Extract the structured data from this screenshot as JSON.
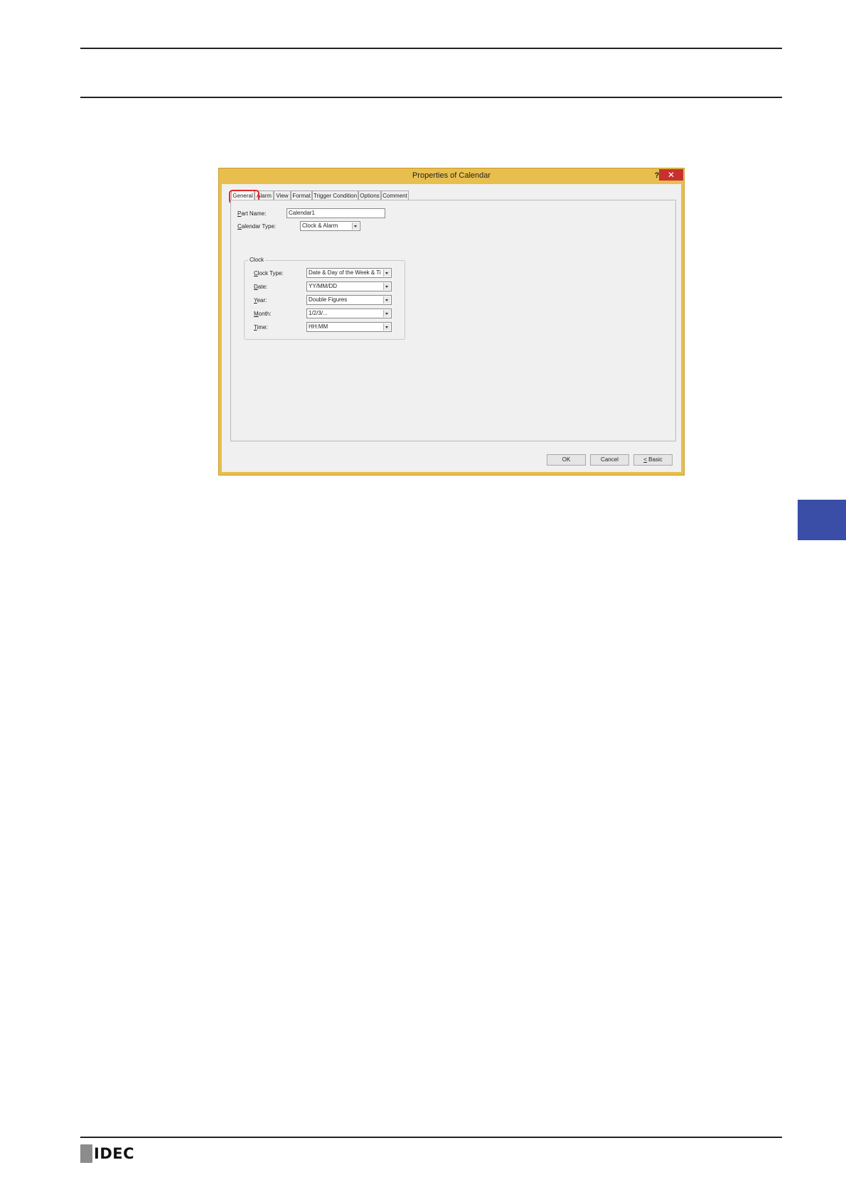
{
  "dialog": {
    "title": "Properties of Calendar",
    "help_label": "?",
    "close_label": "✕",
    "tabs": [
      {
        "label": "General"
      },
      {
        "label": "Alarm"
      },
      {
        "label": "View"
      },
      {
        "label": "Format"
      },
      {
        "label": "Trigger Condition"
      },
      {
        "label": "Options"
      },
      {
        "label": "Comment"
      }
    ],
    "part_name": {
      "label": "Part Name:",
      "label_key": "P",
      "label_rest": "art Name:",
      "value": "Calendar1"
    },
    "calendar_type": {
      "label_key": "C",
      "label_rest": "alendar Type:",
      "value": "Clock & Alarm"
    },
    "clock_group": {
      "title": "Clock",
      "clock_type": {
        "label_key": "C",
        "label_rest": "lock Type:",
        "value": "Date & Day of the Week & Ti"
      },
      "date": {
        "label_key": "D",
        "label_rest": "ate:",
        "value": "YY/MM/DD"
      },
      "year": {
        "label_key": "Y",
        "label_rest": "ear:",
        "value": "Double Figures"
      },
      "month": {
        "label_key": "M",
        "label_rest": "onth:",
        "value": "1/2/3/..."
      },
      "time": {
        "label_key": "T",
        "label_rest": "ime:",
        "value": "HH:MM"
      }
    },
    "buttons": {
      "ok": "OK",
      "cancel": "Cancel",
      "basic": "< Basic",
      "basic_key": "<",
      "basic_rest": " Basic"
    }
  },
  "footer": {
    "logo_text": "IDEC"
  },
  "colors": {
    "accent_highlight": "#e2262a",
    "title_bar": "#e8bf4f",
    "side_tab": "#3a4ea8"
  }
}
